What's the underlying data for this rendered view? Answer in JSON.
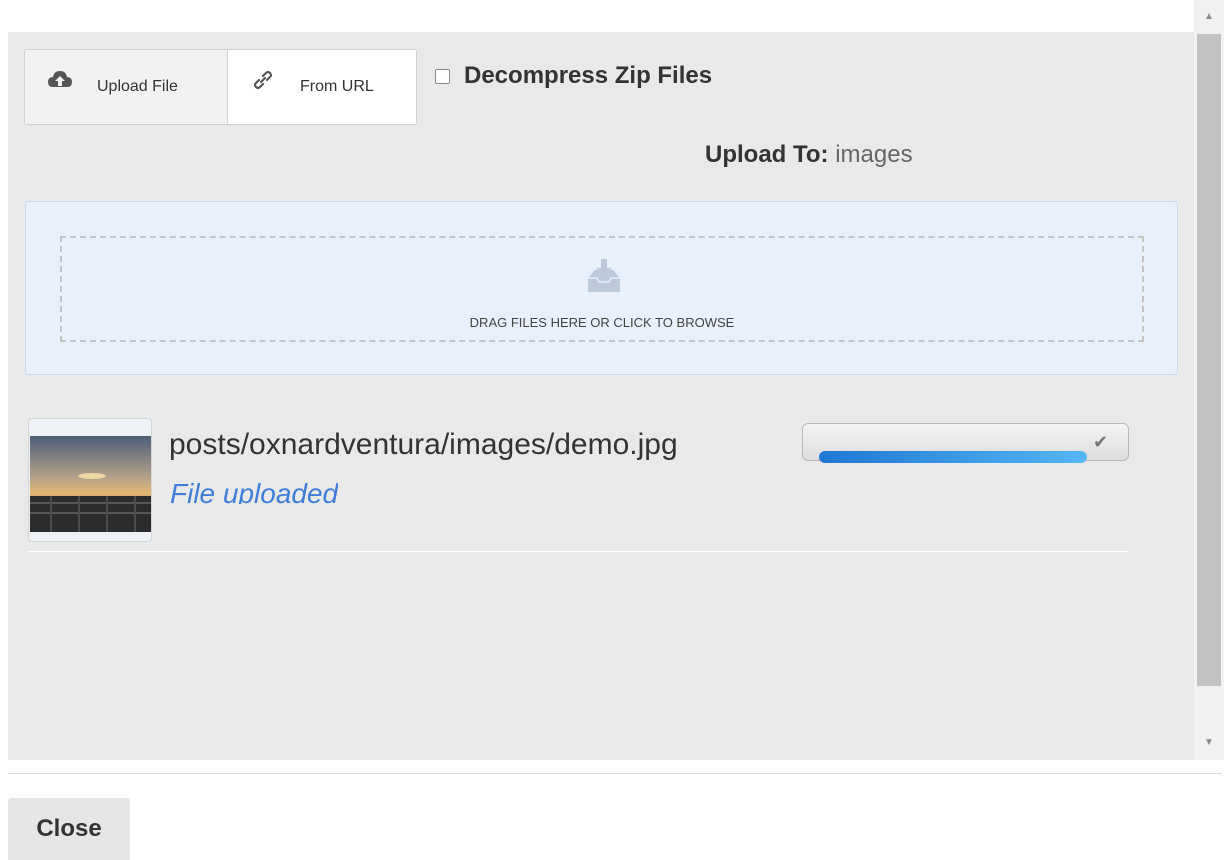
{
  "tabs": {
    "upload_file": {
      "label": "Upload File",
      "icon": "cloud-upload-icon"
    },
    "from_url": {
      "label": "From URL",
      "icon": "link-icon"
    }
  },
  "options": {
    "decompress_label": "Decompress Zip Files",
    "decompress_checked": false
  },
  "upload_to": {
    "label": "Upload To:",
    "value": " images"
  },
  "dropzone": {
    "text": "DRAG FILES HERE OR CLICK TO BROWSE",
    "icon": "inbox-download-icon"
  },
  "files": [
    {
      "path": "posts/oxnardventura/images/demo.jpg",
      "status": "File uploaded",
      "progress": 1.0
    }
  ],
  "footer": {
    "close_label": "Close"
  },
  "colors": {
    "accent": "#3f7fd9",
    "progress_start": "#1f77d4",
    "progress_end": "#55b7f3"
  }
}
